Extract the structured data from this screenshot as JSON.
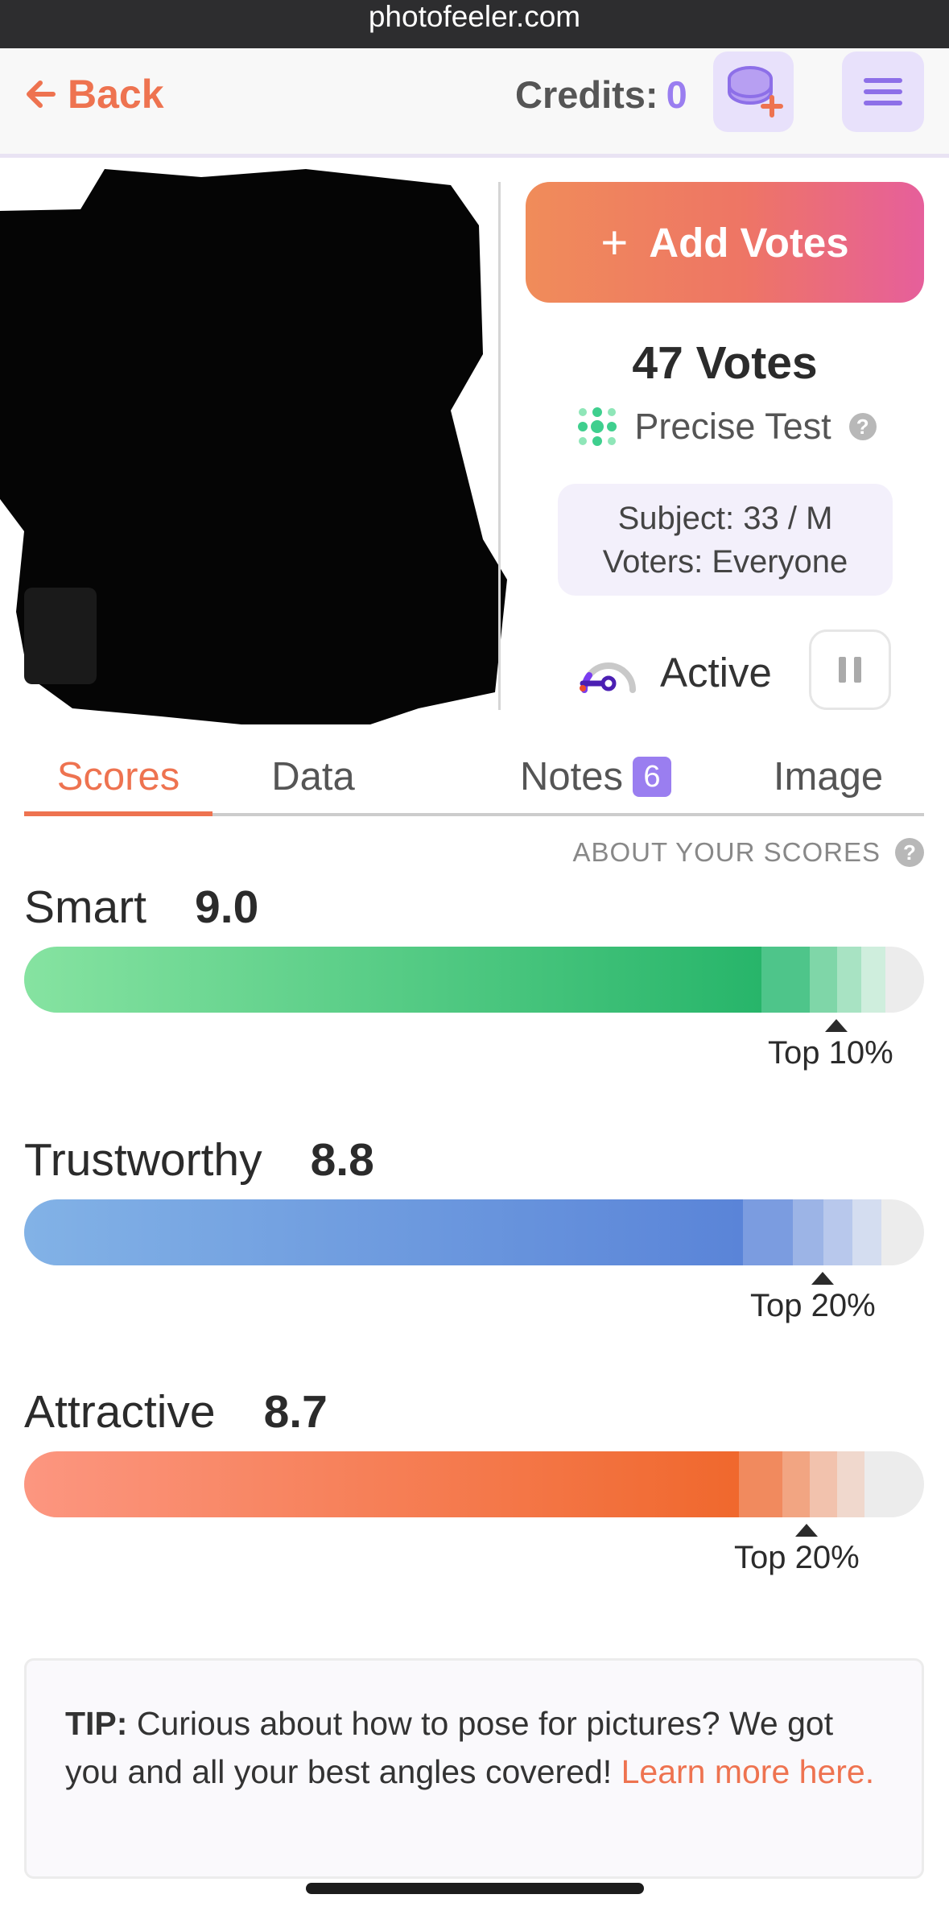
{
  "browser": {
    "url": "photofeeler.com"
  },
  "nav": {
    "back_label": "Back",
    "credits_label": "Credits:",
    "credits_value": "0",
    "coin_icon": "coin-stack-plus-icon",
    "menu_icon": "hamburger-menu-icon"
  },
  "test": {
    "add_votes_label": "Add Votes",
    "votes_count": "47 Votes",
    "test_type": "Precise Test",
    "subject": "Subject: 33 / M",
    "voters": "Voters: Everyone",
    "status": "Active"
  },
  "tabs": [
    {
      "label": "Scores",
      "active": true
    },
    {
      "label": "Data",
      "active": false
    },
    {
      "label": "Notes",
      "badge": "6",
      "active": false
    },
    {
      "label": "Image",
      "active": false
    }
  ],
  "about_scores_label": "ABOUT YOUR SCORES",
  "scores": [
    {
      "label": "Smart",
      "value": "9.0",
      "level": 0.82,
      "percentile": "Top 10%",
      "color": "#2bb36d"
    },
    {
      "label": "Trustworthy",
      "value": "8.8",
      "level": 0.8,
      "percentile": "Top 20%",
      "color": "#5b86d8"
    },
    {
      "label": "Attractive",
      "value": "8.7",
      "level": 0.79,
      "percentile": "Top 20%",
      "color": "#f0682d"
    }
  ],
  "tip": {
    "prefix": "TIP:",
    "text": " Curious about how to pose for pictures? We got you and all your best angles covered! ",
    "link": "Learn more here."
  },
  "colors": {
    "accent": "#ee7350",
    "purple": "#9a7ef0"
  }
}
